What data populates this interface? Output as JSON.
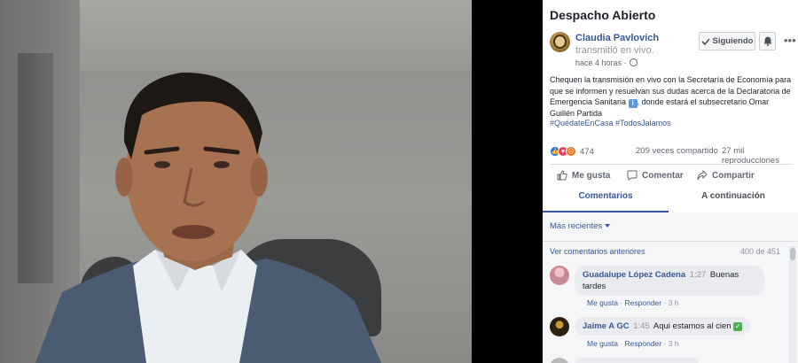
{
  "panel": {
    "title": "Despacho Abierto",
    "author": {
      "name": "Claudia Pavlovich",
      "subtitle": "transmitió en vivo.",
      "time": "hace 4 horas ·"
    },
    "follow_label": "Siguiendo",
    "description": "Chequen la transmisión en vivo con la Secretaría de Economía para que se informen y resuelvan sus dudas acerca de la Declaratoria de Emergencia Sanitaria",
    "description_tail": ", donde estará el subsecretario Omar Guillén Partida",
    "hashtags": "#QuédateEnCasa #TodosJalamos",
    "reaction_count": "474",
    "shares": "209 veces compartido",
    "views": "27 mil reproducciones",
    "actions": {
      "like": "Me gusta",
      "comment": "Comentar",
      "share": "Compartir"
    },
    "tabs": {
      "comments": "Comentarios",
      "next": "A continuación"
    }
  },
  "comments": {
    "sort_label": "Más recientes",
    "previous_link": "Ver comentarios anteriores",
    "count": "400 de 451",
    "items": [
      {
        "name": "Guadalupe López Cadena",
        "time": "1:27",
        "text": "Buenas",
        "text2": "tardes",
        "like": "Me gusta",
        "reply": "Responder",
        "age": "3 h"
      },
      {
        "name": "Jaime A GC",
        "time": "1:45",
        "text": "Aqui estamos al cien",
        "like": "Me gusta",
        "reply": "Responder",
        "age": "3 h"
      }
    ]
  },
  "colors": {
    "link_blue": "#385898",
    "text_dark": "#1d2129",
    "muted": "#90949c",
    "comment_bg": "#f5f6f7"
  }
}
